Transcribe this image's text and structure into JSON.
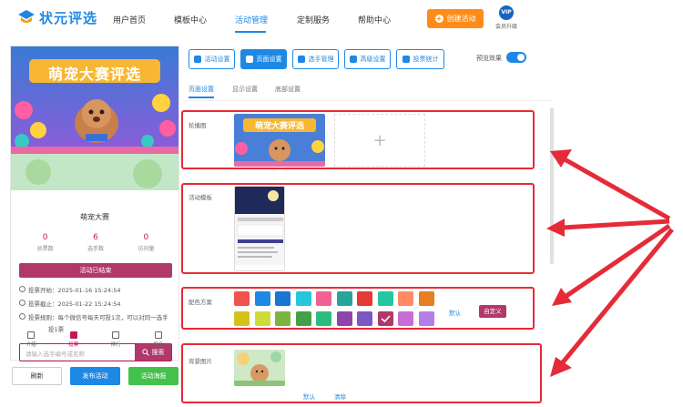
{
  "logo": {
    "text": "状元评选"
  },
  "nav": {
    "items": [
      {
        "label": "用户首页",
        "active": false
      },
      {
        "label": "模板中心",
        "active": false
      },
      {
        "label": "活动管理",
        "active": true
      },
      {
        "label": "定制服务",
        "active": false
      },
      {
        "label": "帮助中心",
        "active": false
      }
    ],
    "create_label": "创建活动",
    "vip_badge": "VIP",
    "vip_label": "会员升级"
  },
  "preview": {
    "banner_title": "萌宠大赛评选",
    "activity_name": "萌宠大赛",
    "stats": [
      {
        "value": "0",
        "label": "总票数"
      },
      {
        "value": "6",
        "label": "选手数"
      },
      {
        "value": "0",
        "label": "访问量"
      }
    ],
    "status_button": "活动已结束",
    "vote_start": "投票开始：2025-01-16 15:24:54",
    "vote_end": "投票截止：2025-01-22 15:24:54",
    "vote_rule_1": "投票规则：每个微信号每天可投1次，可以对同一选手",
    "vote_rule_2": "投1票",
    "search_placeholder": "请输入选手编号或名称",
    "search_button": "搜索",
    "tabbar": [
      {
        "label": "介绍",
        "active": false
      },
      {
        "label": "投票",
        "active": true
      },
      {
        "label": "排行",
        "active": false
      },
      {
        "label": "报名",
        "active": false
      }
    ]
  },
  "bottom_buttons": {
    "refresh": "刷新",
    "publish": "发布活动",
    "poster": "活动海报"
  },
  "settings_tabs": [
    {
      "label": "活动设置",
      "active": false
    },
    {
      "label": "页面设置",
      "active": true
    },
    {
      "label": "选手管理",
      "active": false
    },
    {
      "label": "高级设置",
      "active": false
    },
    {
      "label": "投票统计",
      "active": false
    }
  ],
  "preview_toggle": {
    "label": "预览效果",
    "on": true
  },
  "sub_tabs": [
    {
      "label": "页面设置",
      "active": true
    },
    {
      "label": "显示设置",
      "active": false
    },
    {
      "label": "底部设置",
      "active": false
    }
  ],
  "sections": {
    "carousel": {
      "label": "轮播图",
      "thumb_title": "萌宠大赛评选"
    },
    "template": {
      "label": "活动模板"
    },
    "color": {
      "label": "配色方案",
      "row1": [
        "#ef5350",
        "#1e88e5",
        "#1976d2",
        "#26c6da",
        "#f06292",
        "#26a69a",
        "#e53935",
        "#26c6a0",
        "#ff8a65",
        "#e67e22"
      ],
      "row2": [
        "#d4c21a",
        "#cddc39",
        "#7cb342",
        "#43a047",
        "#2bbd7e",
        "#8e44ad",
        "#7e57c2",
        "#b0386b",
        "#c86dd7",
        "#b57de8"
      ],
      "selected_index": 7,
      "default_label": "默认",
      "custom_label": "自定义"
    },
    "background": {
      "label": "背景图片",
      "default_label": "默认",
      "clear_label": "清除"
    }
  }
}
